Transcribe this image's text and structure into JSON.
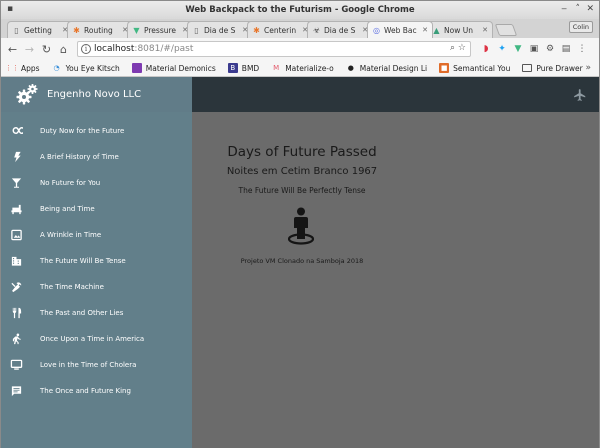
{
  "window": {
    "title": "Web Backpack to the Futurism - Google Chrome"
  },
  "tabs": [
    {
      "label": "Getting",
      "icon": "page-icon",
      "active": false
    },
    {
      "label": "Routing",
      "icon": "asterisk-icon",
      "active": false
    },
    {
      "label": "Pressure",
      "icon": "vue-icon",
      "active": false
    },
    {
      "label": "Dia de S",
      "icon": "page-icon",
      "active": false
    },
    {
      "label": "Centerin",
      "icon": "asterisk-icon",
      "active": false
    },
    {
      "label": "Dia de S",
      "icon": "biohazard-icon",
      "active": false
    },
    {
      "label": "Web Bac",
      "icon": "web-icon",
      "active": true
    },
    {
      "label": "Now Un",
      "icon": "triangle-icon",
      "active": false
    }
  ],
  "profile": {
    "label": "Colin"
  },
  "address": {
    "host": "localhost",
    "path": ":8081/#/past"
  },
  "bookmarks": [
    {
      "label": "Apps",
      "icon": "apps-icon",
      "color": "#e0584a"
    },
    {
      "label": "You Eye Kitsch",
      "icon": "spinner-icon",
      "color": "#3a8fd9"
    },
    {
      "label": "Material Demonics",
      "icon": "square-icon",
      "color": "#7e3ab1"
    },
    {
      "label": "BMD",
      "icon": "b-icon",
      "color": "#3b3b8f"
    },
    {
      "label": "Materialize-o",
      "icon": "m-icon",
      "color": "#e35a6b"
    },
    {
      "label": "Material Design Li",
      "icon": "github-icon",
      "color": "#222222"
    },
    {
      "label": "Semantical You",
      "icon": "box-icon",
      "color": "#e06c2a"
    },
    {
      "label": "Pure Drawer",
      "icon": "folder-icon",
      "color": "#555555"
    }
  ],
  "sidebar": {
    "brand": "Engenho Novo LLC",
    "items": [
      {
        "label": "Duty Now for the Future",
        "icon": "infinity-icon"
      },
      {
        "label": "A Brief History of Time",
        "icon": "flash-icon"
      },
      {
        "label": "No Future for You",
        "icon": "cocktail-icon"
      },
      {
        "label": "Being and Time",
        "icon": "chair-icon"
      },
      {
        "label": "A Wrinkle in Time",
        "icon": "photo-album-icon"
      },
      {
        "label": "The Future Will Be Tense",
        "icon": "building-icon"
      },
      {
        "label": "The Time Machine",
        "icon": "tools-icon"
      },
      {
        "label": "The Past and Other Lies",
        "icon": "restaurant-icon"
      },
      {
        "label": "Once Upon a Time in America",
        "icon": "running-icon"
      },
      {
        "label": "Love in the Time of Cholera",
        "icon": "monitor-icon"
      },
      {
        "label": "The Once and Future King",
        "icon": "comment-icon"
      }
    ]
  },
  "content": {
    "title": "Days of Future Passed",
    "subtitle": "Noites em Cetim Branco 1967",
    "motto": "The Future Will Be Perfectly Tense",
    "footer": "Projeto VM Clonado na Samboja 2018",
    "icon": "person-pin-icon"
  },
  "colors": {
    "sidebar": "#627f8a",
    "appbar": "#2b353b",
    "content_bg": "#6b6b6b"
  }
}
